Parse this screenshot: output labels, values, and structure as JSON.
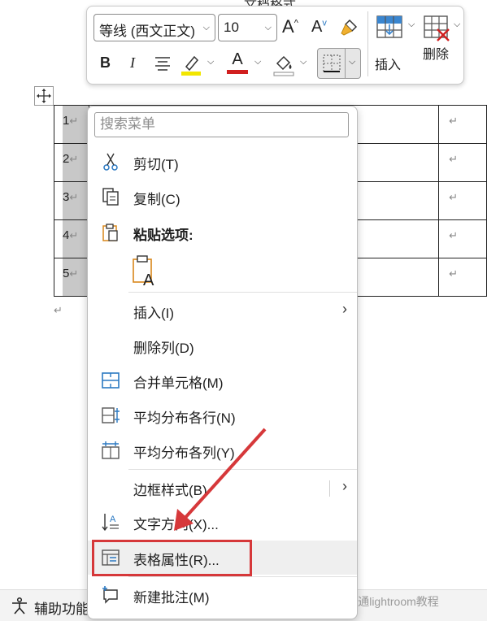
{
  "document": {
    "title_partial": "文档格式",
    "row_numbers": [
      "1",
      "2",
      "3",
      "4",
      "5"
    ],
    "return_mark": "↵"
  },
  "mini_toolbar": {
    "font_name": "等线 (西文正文)",
    "font_size": "10",
    "insert_label": "插入",
    "delete_label": "删除",
    "bold_glyph": "B",
    "italic_glyph": "I",
    "grow_font_glyph": "A",
    "shrink_font_glyph": "A",
    "font_color_glyph": "A",
    "highlight_color": "#f2e600",
    "font_color": "#d11f1f"
  },
  "context_menu": {
    "search_placeholder": "搜索菜单",
    "items": [
      {
        "label": "剪切(T)",
        "icon": "scissors-icon"
      },
      {
        "label": "复制(C)",
        "icon": "copy-icon"
      },
      {
        "label": "粘贴选项:",
        "icon": "paste-icon"
      },
      {
        "label": "插入(I)",
        "icon": "",
        "submenu": true
      },
      {
        "label": "删除列(D)",
        "icon": ""
      },
      {
        "label": "合并单元格(M)",
        "icon": "merge-cells-icon"
      },
      {
        "label": "平均分布各行(N)",
        "icon": "distribute-rows-icon"
      },
      {
        "label": "平均分布各列(Y)",
        "icon": "distribute-columns-icon"
      },
      {
        "label": "边框样式(B)",
        "icon": "",
        "submenu": true
      },
      {
        "label": "文字方向(X)...",
        "icon": "text-direction-icon"
      },
      {
        "label": "表格属性(R)...",
        "icon": "table-properties-icon"
      },
      {
        "label": "新建批注(M)",
        "icon": "new-comment-icon"
      }
    ],
    "submenu_glyph": "›",
    "accent_color": "#2b79c2",
    "highlight_box_color": "#d6383a"
  },
  "status_bar": {
    "accessibility_label": "辅助功能",
    "watermark": "@互通lightroom教程"
  }
}
